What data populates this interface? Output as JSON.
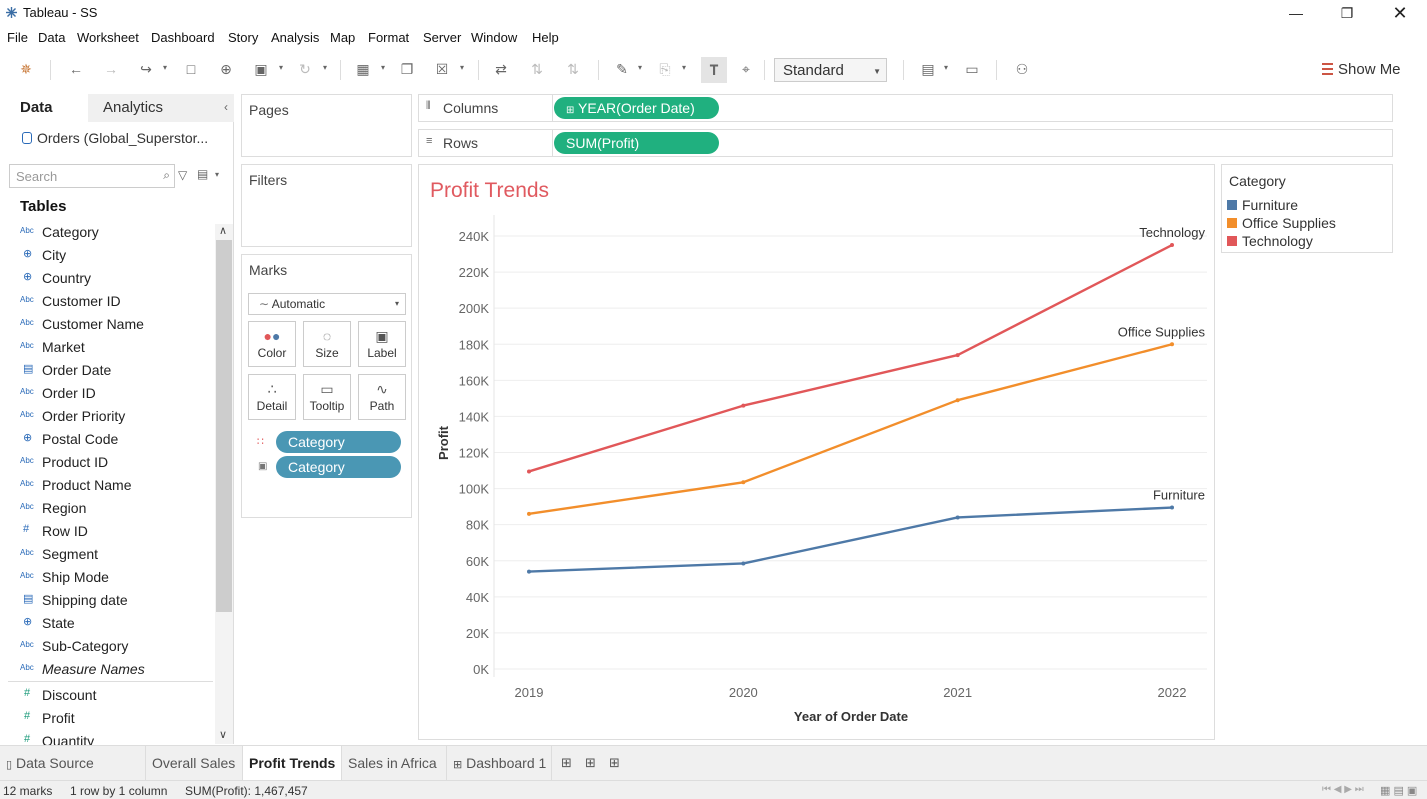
{
  "window": {
    "title": "Tableau - SS",
    "minimize_icon": "minimize-icon",
    "restore_icon": "restore-icon",
    "close_icon": "close-icon"
  },
  "menu": [
    "File",
    "Data",
    "Worksheet",
    "Dashboard",
    "Story",
    "Analysis",
    "Map",
    "Format",
    "Server",
    "Window",
    "Help"
  ],
  "toolbar": {
    "fit_value": "Standard",
    "show_me": "Show Me"
  },
  "data_pane": {
    "tab_data": "Data",
    "tab_analytics": "Analytics",
    "datasource": "Orders (Global_Superstor...",
    "search_placeholder": "Search",
    "tables_title": "Tables",
    "dimensions": [
      {
        "type": "Abc",
        "name": "Category"
      },
      {
        "type": "geo",
        "name": "City"
      },
      {
        "type": "geo",
        "name": "Country"
      },
      {
        "type": "Abc",
        "name": "Customer ID"
      },
      {
        "type": "Abc",
        "name": "Customer Name"
      },
      {
        "type": "Abc",
        "name": "Market"
      },
      {
        "type": "date",
        "name": "Order Date"
      },
      {
        "type": "Abc",
        "name": "Order ID"
      },
      {
        "type": "Abc",
        "name": "Order Priority"
      },
      {
        "type": "geo",
        "name": "Postal Code"
      },
      {
        "type": "Abc",
        "name": "Product ID"
      },
      {
        "type": "Abc",
        "name": "Product Name"
      },
      {
        "type": "Abc",
        "name": "Region"
      },
      {
        "type": "#",
        "name": "Row ID"
      },
      {
        "type": "Abc",
        "name": "Segment"
      },
      {
        "type": "Abc",
        "name": "Ship Mode"
      },
      {
        "type": "date",
        "name": "Shipping date"
      },
      {
        "type": "geo",
        "name": "State"
      },
      {
        "type": "Abc",
        "name": "Sub-Category"
      },
      {
        "type": "Abc",
        "name": "Measure Names"
      }
    ],
    "measures": [
      {
        "type": "#",
        "name": "Discount"
      },
      {
        "type": "#",
        "name": "Profit"
      },
      {
        "type": "#",
        "name": "Quantity"
      }
    ]
  },
  "cards": {
    "pages": "Pages",
    "filters": "Filters",
    "marks": "Marks",
    "columns": "Columns",
    "rows": "Rows"
  },
  "shelves": {
    "columns_pill": "YEAR(Order Date)",
    "rows_pill": "SUM(Profit)"
  },
  "marks": {
    "type": "Automatic",
    "buttons": [
      "Color",
      "Size",
      "Label",
      "Detail",
      "Tooltip",
      "Path"
    ],
    "color_pill": "Category",
    "label_pill": "Category"
  },
  "legend": {
    "title": "Category",
    "items": [
      {
        "name": "Furniture",
        "color": "#4e79a7"
      },
      {
        "name": "Office Supplies",
        "color": "#f28e2b"
      },
      {
        "name": "Technology",
        "color": "#e15759"
      }
    ]
  },
  "chart_data": {
    "type": "line",
    "title": "Profit Trends",
    "xlabel": "Year of Order Date",
    "ylabel": "Profit",
    "categories": [
      "2019",
      "2020",
      "2021",
      "2022"
    ],
    "yticks": [
      "0K",
      "20K",
      "40K",
      "60K",
      "80K",
      "100K",
      "120K",
      "140K",
      "160K",
      "180K",
      "200K",
      "220K",
      "240K"
    ],
    "ylim": [
      0,
      245000
    ],
    "grid": true,
    "series": [
      {
        "name": "Furniture",
        "color": "#4e79a7",
        "values": [
          54000,
          58500,
          84000,
          89500
        ]
      },
      {
        "name": "Office Supplies",
        "color": "#f28e2b",
        "values": [
          86000,
          103500,
          149000,
          180000
        ]
      },
      {
        "name": "Technology",
        "color": "#e15759",
        "values": [
          109500,
          146000,
          174000,
          235000
        ]
      }
    ]
  },
  "sheet_tabs": [
    {
      "label": "Data Source",
      "active": false
    },
    {
      "label": "Overall Sales",
      "active": false
    },
    {
      "label": "Profit Trends",
      "active": true
    },
    {
      "label": "Sales in Africa",
      "active": false
    },
    {
      "label": "Dashboard 1",
      "active": false
    }
  ],
  "status": {
    "marks": "12 marks",
    "rows_cols": "1 row by 1 column",
    "sum": "SUM(Profit): 1,467,457"
  }
}
